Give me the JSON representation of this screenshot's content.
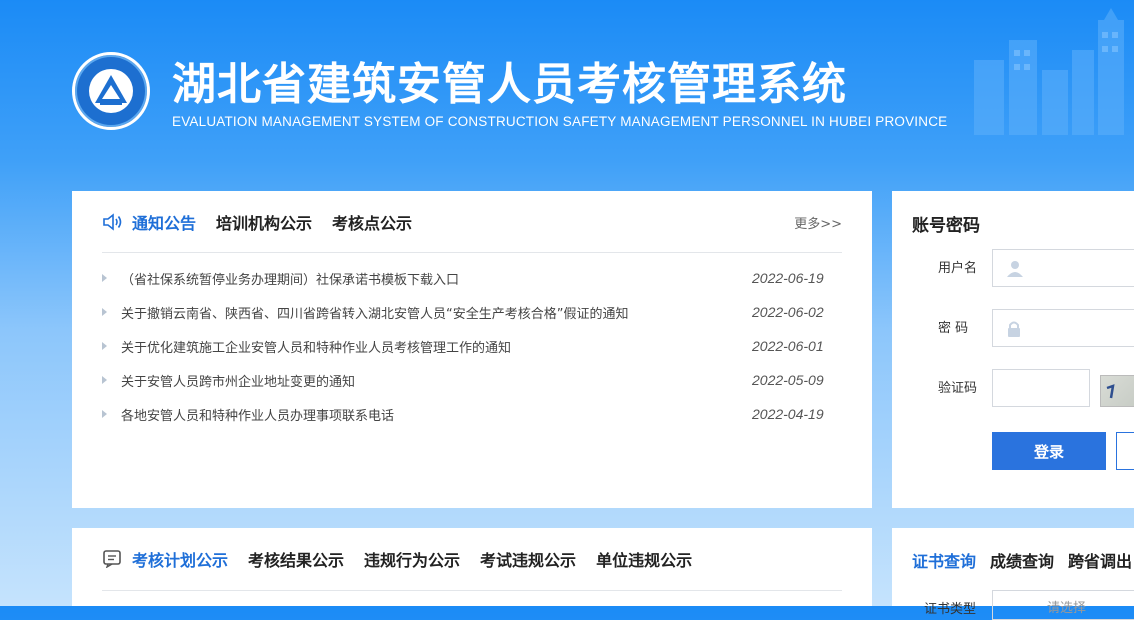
{
  "header": {
    "title": "湖北省建筑安管人员考核管理系统",
    "subtitle": "EVALUATION MANAGEMENT SYSTEM OF CONSTRUCTION SAFETY MANAGEMENT PERSONNEL IN HUBEI PROVINCE",
    "logo_text": "湖北省建筑安管人员考核管理系统"
  },
  "notices": {
    "tabs": [
      {
        "label": "通知公告",
        "active": true
      },
      {
        "label": "培训机构公示",
        "active": false
      },
      {
        "label": "考核点公示",
        "active": false
      }
    ],
    "more": "更多>>",
    "items": [
      {
        "title": "（省社保系统暂停业务办理期间）社保承诺书模板下载入口",
        "date": "2022-06-19"
      },
      {
        "title": "关于撤销云南省、陕西省、四川省跨省转入湖北安管人员“安全生产考核合格”假证的通知",
        "date": "2022-06-02"
      },
      {
        "title": "关于优化建筑施工企业安管人员和特种作业人员考核管理工作的通知",
        "date": "2022-06-01"
      },
      {
        "title": "关于安管人员跨市州企业地址变更的通知",
        "date": "2022-05-09"
      },
      {
        "title": "各地安管人员和特种作业人员办理事项联系电话",
        "date": "2022-04-19"
      }
    ]
  },
  "login": {
    "title": "账号密码",
    "username_label": "用户名",
    "password_label": "密 码",
    "captcha_label": "验证码",
    "login_button": "登录"
  },
  "exam": {
    "tabs": [
      {
        "label": "考核计划公示",
        "active": true
      },
      {
        "label": "考核结果公示",
        "active": false
      },
      {
        "label": "违规行为公示",
        "active": false
      },
      {
        "label": "考试违规公示",
        "active": false
      },
      {
        "label": "单位违规公示",
        "active": false
      }
    ]
  },
  "cert": {
    "tabs": [
      {
        "label": "证书查询",
        "active": true
      },
      {
        "label": "成绩查询",
        "active": false
      },
      {
        "label": "跨省调出",
        "active": false
      }
    ],
    "type_label": "证书类型",
    "type_placeholder": "请选择"
  },
  "colors": {
    "accent": "#1f6fd8",
    "button": "#2a73de"
  }
}
